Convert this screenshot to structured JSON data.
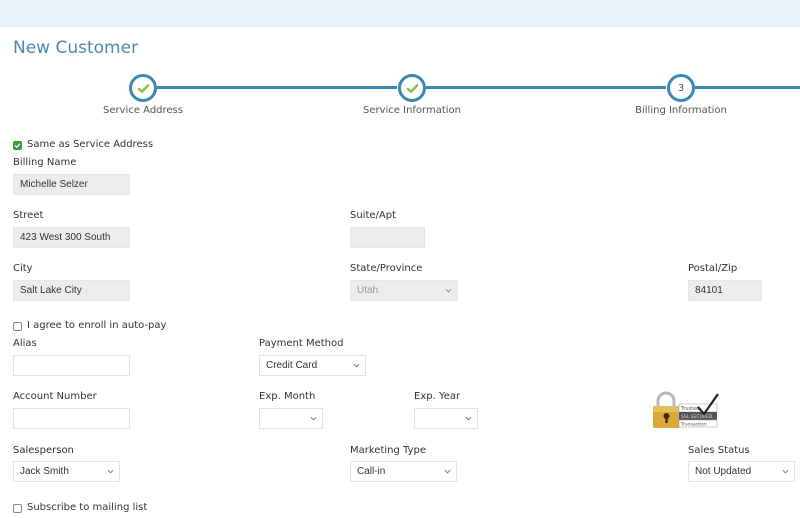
{
  "page": {
    "title": "New Customer"
  },
  "stepper": {
    "steps": [
      {
        "label": "Service Address",
        "state": "complete",
        "icon": "check-icon"
      },
      {
        "label": "Service Information",
        "state": "complete",
        "icon": "check-icon"
      },
      {
        "label": "Billing Information",
        "state": "current",
        "number": "3"
      }
    ],
    "colors": {
      "line": "#3d87b5",
      "check": "#8cc43f"
    }
  },
  "billing": {
    "same_as_service": {
      "label": "Same as Service Address",
      "checked": true
    },
    "billing_name": {
      "label": "Billing Name",
      "value": "Michelle Selzer"
    },
    "street": {
      "label": "Street",
      "value": "423 West 300 South"
    },
    "suite": {
      "label": "Suite/Apt",
      "value": ""
    },
    "city": {
      "label": "City",
      "value": "Salt Lake City"
    },
    "state": {
      "label": "State/Province",
      "value": "Utah"
    },
    "postal": {
      "label": "Postal/Zip",
      "value": "84101"
    }
  },
  "payment": {
    "autopay": {
      "label": "I agree to enroll in auto-pay",
      "checked": false
    },
    "alias": {
      "label": "Alias",
      "value": ""
    },
    "method": {
      "label": "Payment Method",
      "value": "Credit Card"
    },
    "account_number": {
      "label": "Account Number",
      "value": ""
    },
    "exp_month": {
      "label": "Exp. Month",
      "value": ""
    },
    "exp_year": {
      "label": "Exp. Year",
      "value": ""
    },
    "trust_badge": {
      "line1": "Trusted",
      "line2": "SSL SECURED",
      "line3": "Transaction",
      "icon": "padlock-icon"
    }
  },
  "sales": {
    "salesperson": {
      "label": "Salesperson",
      "value": "Jack Smith"
    },
    "marketing_type": {
      "label": "Marketing Type",
      "value": "Call-in"
    },
    "sales_status": {
      "label": "Sales Status",
      "value": "Not Updated"
    },
    "mailing_list": {
      "label": "Subscribe to mailing list",
      "checked": false
    }
  }
}
